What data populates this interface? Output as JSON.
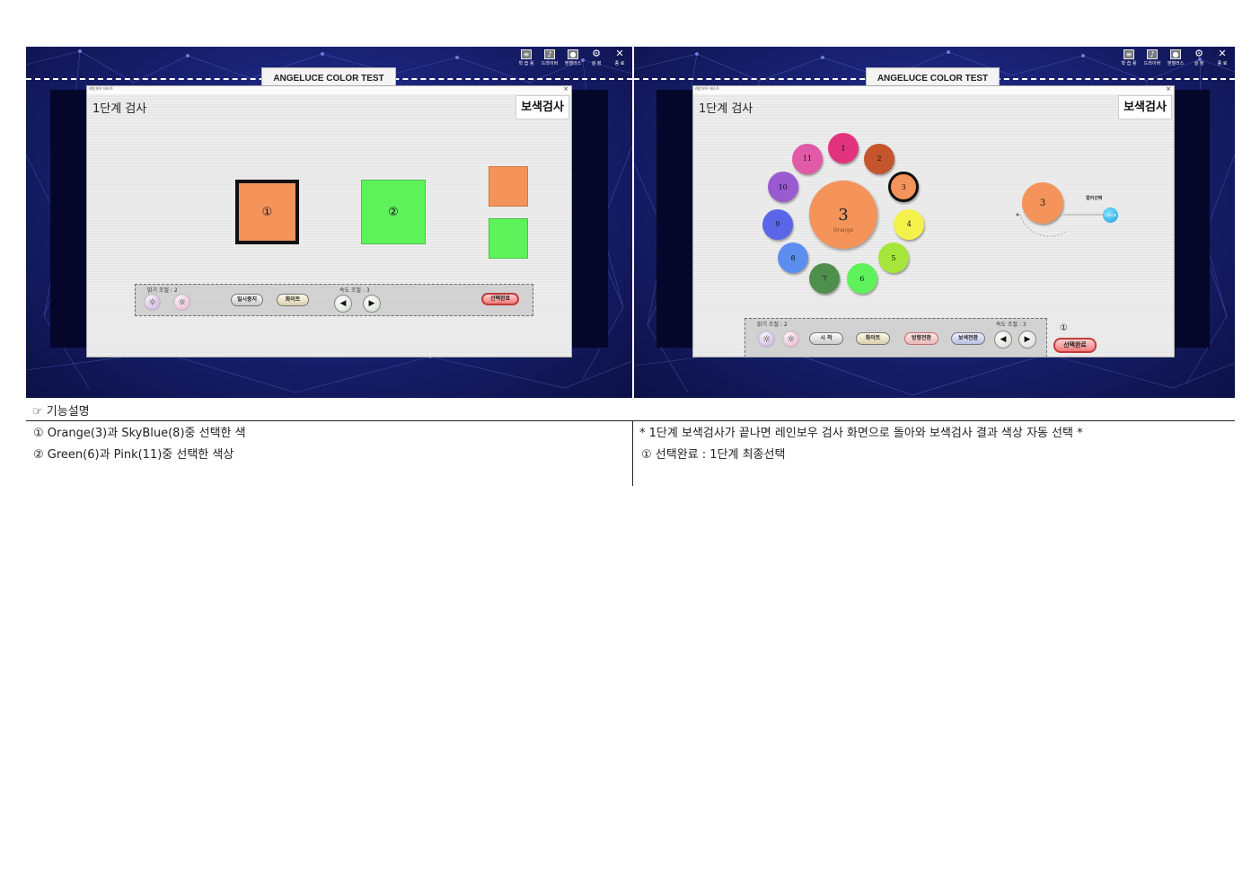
{
  "toolbar": {
    "items": [
      {
        "icon": "practice-icon",
        "label": "학 습 용"
      },
      {
        "icon": "driver-icon",
        "label": "드라이버"
      },
      {
        "icon": "angeluce-icon",
        "label": "엔젤러스"
      },
      {
        "icon": "gear-icon",
        "label": "설 정"
      },
      {
        "icon": "close-icon",
        "label": "종 료"
      }
    ]
  },
  "app_title": "ANGELUCE COLOR TEST",
  "left_screen": {
    "dialog_title": "레인보우 테스트",
    "stage_title": "1단계 검사",
    "mode": "보색검사",
    "square_1_label": "①",
    "square_2_label": "②",
    "colors": {
      "orange": "#f4945a",
      "green": "#5ef25a"
    },
    "brightness_label": "밝기 조절 : 2",
    "pause_label": "일시중지",
    "white_label": "화이트",
    "speed_label": "속도 조절 : 3",
    "confirm_label": "선택완료"
  },
  "right_screen": {
    "dialog_title": "레인보우 테스트",
    "stage_title": "1단계 검사",
    "mode": "보색검사",
    "wheel": [
      {
        "num": "1",
        "color": "#e2337e"
      },
      {
        "num": "2",
        "color": "#c4552c"
      },
      {
        "num": "3",
        "color": "#f4945a",
        "selected": true
      },
      {
        "num": "4",
        "color": "#f4f24a"
      },
      {
        "num": "5",
        "color": "#a6e63a"
      },
      {
        "num": "6",
        "color": "#5ef25a"
      },
      {
        "num": "7",
        "color": "#4f8f4c"
      },
      {
        "num": "8",
        "color": "#5c8ef0"
      },
      {
        "num": "9",
        "color": "#5a66e8"
      },
      {
        "num": "10",
        "color": "#9a5ad0"
      },
      {
        "num": "11",
        "color": "#e05aa8"
      }
    ],
    "center_number": "3",
    "center_name": "Orange",
    "selected_number": "3",
    "color_select_label": "컬러선택",
    "cancel_label": "Cancel",
    "brightness_label": "밝기 조절 : 2",
    "speed_label": "속도 조절 : 3",
    "start_label": "시 작",
    "white_label": "화이트",
    "direction_label": "방향전환",
    "mode_switch_label": "보색전환",
    "marker": "①",
    "confirm_label": "선택완료"
  },
  "description": {
    "heading": "☞ 기능설명",
    "left_lines": [
      "①  Orange(3)과 SkyBlue(8)중 선택한 색",
      "②  Green(6)과 Pink(11)중 선택한 색상"
    ],
    "right_lines": [
      "  *  1단계 보색검사가 끝나면 레인보우 검사 화면으로 돌아와 보색검사 결과 색상 자동 선택 *",
      "①  선택완료 : 1단계 최종선택"
    ]
  }
}
